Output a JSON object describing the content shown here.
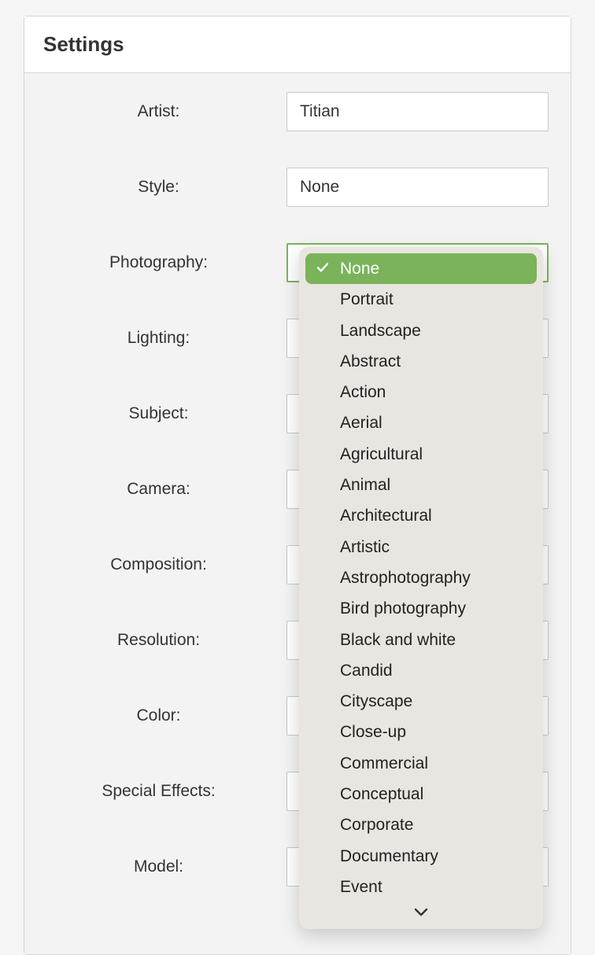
{
  "panel": {
    "title": "Settings"
  },
  "fields": {
    "artist": {
      "label": "Artist:",
      "value": "Titian"
    },
    "style": {
      "label": "Style:",
      "value": "None"
    },
    "photography": {
      "label": "Photography:",
      "value": "None"
    },
    "lighting": {
      "label": "Lighting:",
      "value": ""
    },
    "subject": {
      "label": "Subject:",
      "value": ""
    },
    "camera": {
      "label": "Camera:",
      "value": ""
    },
    "composition": {
      "label": "Composition:",
      "value": ""
    },
    "resolution": {
      "label": "Resolution:",
      "value": ""
    },
    "color": {
      "label": "Color:",
      "value": ""
    },
    "special_effects": {
      "label": "Special Effects:",
      "value": ""
    },
    "model": {
      "label": "Model:",
      "value": ""
    }
  },
  "dropdown": {
    "selected": "None",
    "options": [
      "None",
      "Portrait",
      "Landscape",
      "Abstract",
      "Action",
      "Aerial",
      "Agricultural",
      "Animal",
      "Architectural",
      "Artistic",
      "Astrophotography",
      "Bird photography",
      "Black and white",
      "Candid",
      "Cityscape",
      "Close-up",
      "Commercial",
      "Conceptual",
      "Corporate",
      "Documentary",
      "Event"
    ]
  }
}
